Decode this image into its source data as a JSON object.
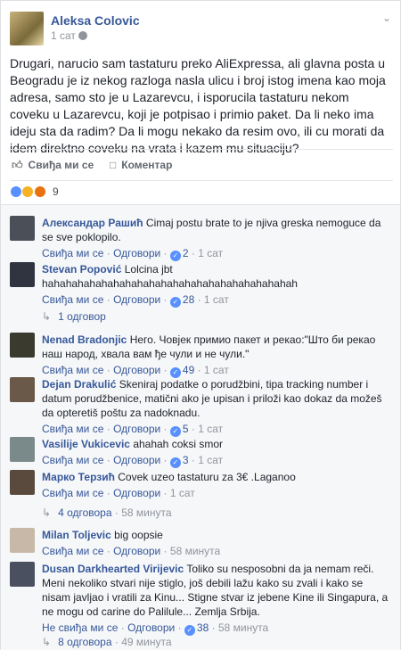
{
  "post": {
    "author": "Aleksa Colovic",
    "time": "1 сат",
    "text": "Drugari, narucio sam tastaturu preko AliExpressa, ali glavna posta u Beogradu je iz nekog razloga nasla ulicu i broj istog imena kao moja adresa, samo sto je u Lazarevcu, i isporucila tastaturu nekom coveku u Lazarevcu, koji je potpisao i primio paket. Da li neko ima ideju sta da radim? Da li mogu nekako da resim ovo, ili cu morati da idem direktno coveku na vrata i kazem mu situaciju?",
    "like_label": "Свиђа ми се",
    "comment_label": "Коментар",
    "reaction_count": "9",
    "icons": {
      "like": "thumbs-up-icon",
      "comment": "speech-bubble-icon",
      "globe": "globe-icon",
      "options": "chevron-down-icon"
    }
  },
  "comments": [
    {
      "name": "Александар Рашић",
      "text": "Cimaj postu brate to je njiva greska nemoguce da se sve poklopilo.",
      "like": "Свиђа ми се",
      "reply": "Одговори",
      "likes": "2",
      "time": "1 сат"
    },
    {
      "name": "Stevan Popović",
      "text": "Lolcina jbt hahahahahahahahahahahahahahahahahahahahahah",
      "like": "Свиђа ми се",
      "reply": "Одговори",
      "likes": "28",
      "time": "1 сат",
      "replies": "1 одговор"
    },
    {
      "name": "Nenad Bradonjic",
      "text": "Него. Човјек примио пакет и рекао:\"Што би рекао наш народ, хвала вам ђе чули и не чули.\"",
      "like": "Свиђа ми се",
      "reply": "Одговори",
      "likes": "49",
      "time": "1 сат"
    },
    {
      "name": "Dejan Drakulić",
      "text": "Skeniraj podatke o porudžbini, tipa tracking number i datum porudžbenice, matični ako je upisan i priloži kao dokaz da možeš da opteretiš poštu za nadoknadu.",
      "like": "Свиђа ми се",
      "reply": "Одговори",
      "likes": "5",
      "time": "1 сат"
    },
    {
      "name": "Vasilije Vukicevic",
      "text": "ahahah coksi smor",
      "like": "Свиђа ми се",
      "reply": "Одговори",
      "likes": "3",
      "time": "1 сат"
    },
    {
      "name": "Марко Терзић",
      "text": "Covek uzeo tastaturu za 3€ .Laganoo",
      "like": "Свиђа ми се",
      "reply": "Одговори",
      "likes": "",
      "time": "1 сат",
      "replies": "4 одговора",
      "replies_time": "58 минута"
    },
    {
      "name": "Milan Toljevic",
      "text": "big oopsie",
      "like": "Свиђа ми се",
      "reply": "Одговори",
      "likes": "",
      "time": "58 минута"
    },
    {
      "name": "Dusan Darkhearted Virijevic",
      "text": "Toliko su nesposobni da ja nemam reči. Meni nekoliko stvari nije stiglo, još debili lažu kako su zvali i kako se nisam javljao i vratili za Kinu... Stigne stvar iz jebene Kine ili Singapura, a ne mogu od carine do Palilule... Zemlja Srbija.",
      "like": "Не свиђа ми се",
      "reply": "Одговори",
      "likes": "38",
      "time": "58 минута",
      "replies": "8 одговора",
      "replies_time": "49 минута"
    }
  ]
}
